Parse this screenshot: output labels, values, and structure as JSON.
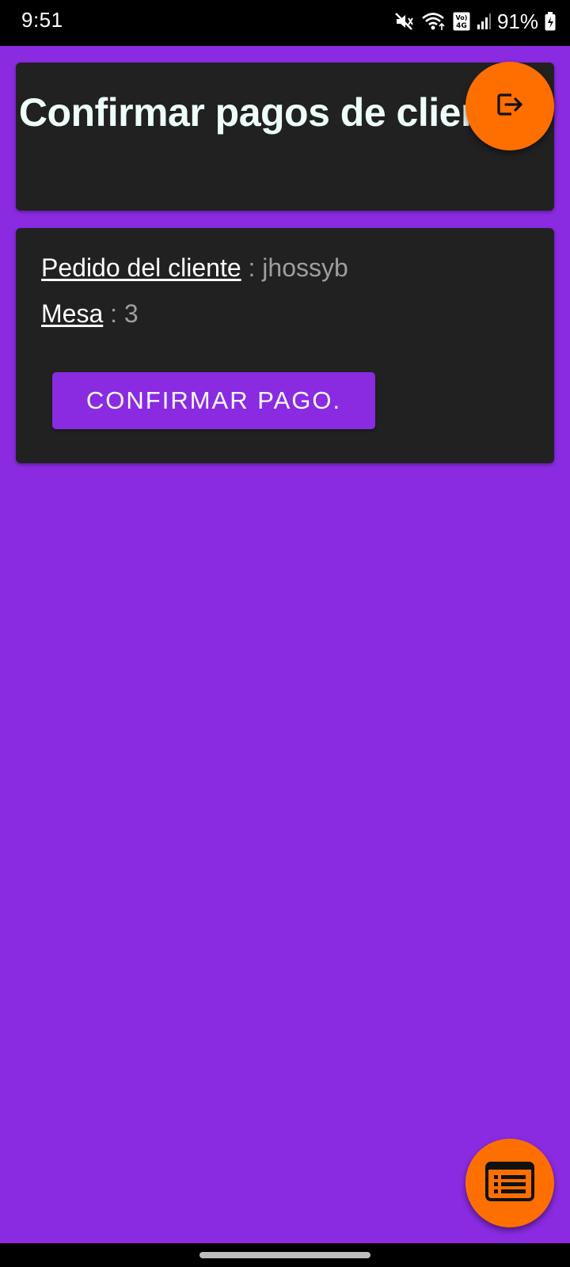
{
  "status_bar": {
    "time": "9:51",
    "network_label": "Vo) 4G",
    "battery_percent": "91%",
    "icons": [
      "mute-icon",
      "wifi-icon",
      "volte-icon",
      "signal-icon",
      "battery-charging-icon"
    ]
  },
  "header": {
    "title": "Confirmar pagos de clientes."
  },
  "order": {
    "client_label": "Pedido del cliente",
    "client_value": " : jhossyb",
    "table_label": "Mesa",
    "table_value": " : 3",
    "confirm_label": "CONFIRMAR PAGO."
  },
  "fabs": {
    "logout_icon": "logout-icon",
    "orders_icon": "order-list-icon"
  },
  "colors": {
    "background": "#8a2be2",
    "card": "#212121",
    "accent": "#ff6f00",
    "title_text": "#eefffb",
    "value_text": "#9e9e9e"
  }
}
